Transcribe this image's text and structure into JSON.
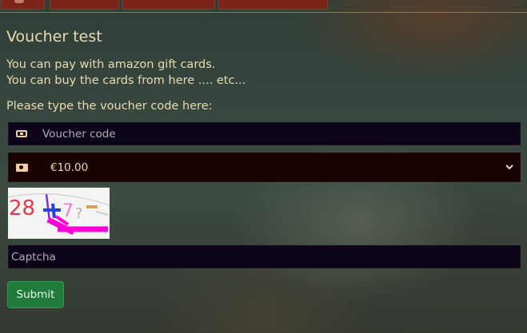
{
  "nav": {
    "tabs": [
      {
        "icon": "tab-icon"
      },
      {
        "icon": ""
      },
      {
        "icon": ""
      },
      {
        "icon": ""
      }
    ]
  },
  "page": {
    "title": "Voucher test",
    "lines": [
      "You can pay with amazon gift cards.",
      "You can buy the cards from here .... etc..."
    ],
    "prompt": "Please type the voucher code here:"
  },
  "form": {
    "voucher": {
      "placeholder": "Voucher code",
      "value": "",
      "icon": "ticket-icon"
    },
    "amount": {
      "selected": "€10.00",
      "icon": "money-bill-icon"
    },
    "captcha": {
      "image_text": "28 + 7 - ?",
      "placeholder": "Captcha",
      "value": ""
    },
    "submit_label": "Submit"
  },
  "colors": {
    "accent_green": "#1f7a3c",
    "nav_red": "#7c2419",
    "text": "#eadbb0",
    "input_bg": "#0c0418"
  }
}
